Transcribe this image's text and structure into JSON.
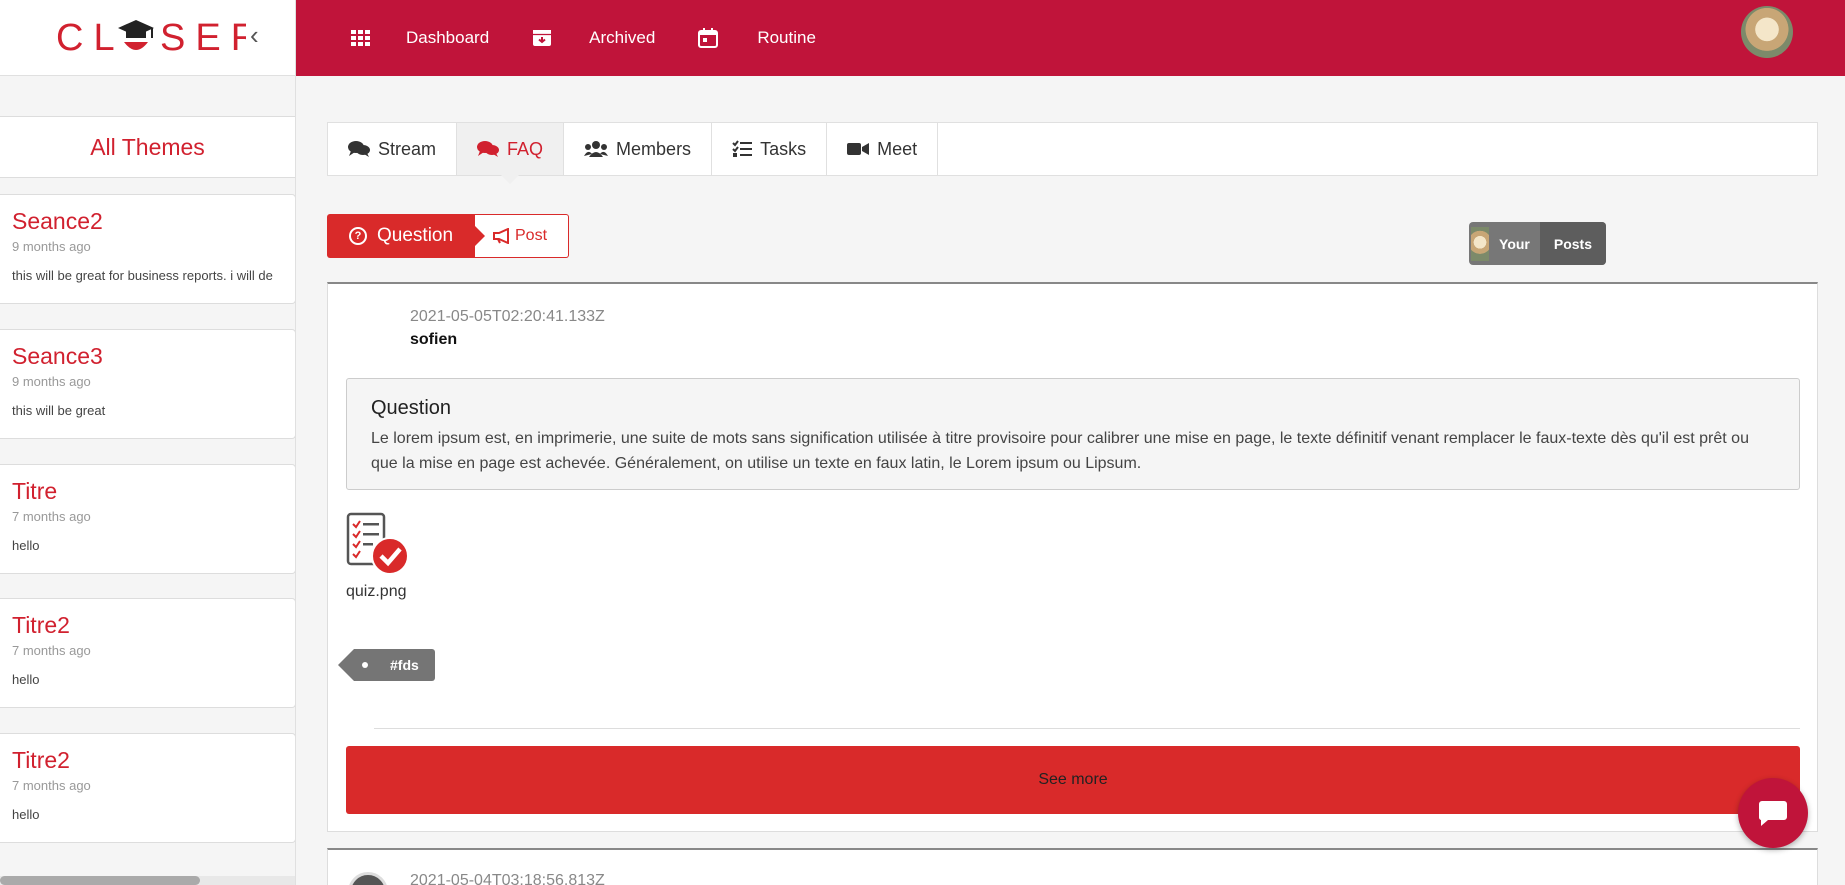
{
  "app": {
    "logo_text": "CLOSER",
    "brand_color": "#c0143a",
    "accent_color": "#d92a2a"
  },
  "sidebar": {
    "all_themes_label": "All Themes",
    "items": [
      {
        "title": "Seance2",
        "time": "9 months ago",
        "desc": "this will be great for business reports. i will de"
      },
      {
        "title": "Seance3",
        "time": "9 months ago",
        "desc": "this will be great"
      },
      {
        "title": "Titre",
        "time": "7 months ago",
        "desc": "hello"
      },
      {
        "title": "Titre2",
        "time": "7 months ago",
        "desc": "hello"
      },
      {
        "title": "Titre2",
        "time": "7 months ago",
        "desc": "hello"
      }
    ]
  },
  "topnav": {
    "items": [
      {
        "label": "Dashboard",
        "icon": "grid-icon"
      },
      {
        "label": "Archived",
        "icon": "archive-icon"
      },
      {
        "label": "Routine",
        "icon": "calendar-icon"
      }
    ]
  },
  "tabs": [
    {
      "label": "Stream",
      "icon": "comments-icon",
      "active": false
    },
    {
      "label": "FAQ",
      "icon": "comments-icon",
      "active": true
    },
    {
      "label": "Members",
      "icon": "users-icon",
      "active": false
    },
    {
      "label": "Tasks",
      "icon": "tasks-icon",
      "active": false
    },
    {
      "label": "Meet",
      "icon": "video-icon",
      "active": false
    }
  ],
  "toggle": {
    "question_label": "Question",
    "post_label": "Post"
  },
  "your_posts": {
    "your": "Your",
    "posts": "Posts"
  },
  "post": {
    "date": "2021-05-05T02:20:41.133Z",
    "author": "sofien",
    "question_title": "Question",
    "question_text": "Le lorem ipsum est, en imprimerie, une suite de mots sans signification utilisée à titre provisoire pour calibrer une mise en page, le texte définitif venant remplacer le faux-texte dès qu'il est prêt ou que la mise en page est achevée. Généralement, on utilise un texte en faux latin, le Lorem ipsum ou Lipsum.",
    "attachment_name": "quiz.png",
    "tag": "#fds",
    "see_more_label": "See more"
  },
  "post2": {
    "date": "2021-05-04T03:18:56.813Z"
  }
}
